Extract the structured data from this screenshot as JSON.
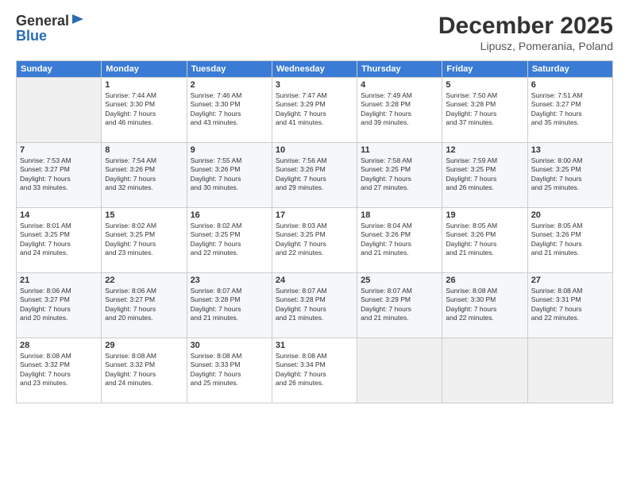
{
  "logo": {
    "general": "General",
    "blue": "Blue"
  },
  "header": {
    "month": "December 2025",
    "location": "Lipusz, Pomerania, Poland"
  },
  "weekdays": [
    "Sunday",
    "Monday",
    "Tuesday",
    "Wednesday",
    "Thursday",
    "Friday",
    "Saturday"
  ],
  "weeks": [
    [
      {
        "day": "",
        "info": ""
      },
      {
        "day": "1",
        "info": "Sunrise: 7:44 AM\nSunset: 3:30 PM\nDaylight: 7 hours\nand 46 minutes."
      },
      {
        "day": "2",
        "info": "Sunrise: 7:46 AM\nSunset: 3:30 PM\nDaylight: 7 hours\nand 43 minutes."
      },
      {
        "day": "3",
        "info": "Sunrise: 7:47 AM\nSunset: 3:29 PM\nDaylight: 7 hours\nand 41 minutes."
      },
      {
        "day": "4",
        "info": "Sunrise: 7:49 AM\nSunset: 3:28 PM\nDaylight: 7 hours\nand 39 minutes."
      },
      {
        "day": "5",
        "info": "Sunrise: 7:50 AM\nSunset: 3:28 PM\nDaylight: 7 hours\nand 37 minutes."
      },
      {
        "day": "6",
        "info": "Sunrise: 7:51 AM\nSunset: 3:27 PM\nDaylight: 7 hours\nand 35 minutes."
      }
    ],
    [
      {
        "day": "7",
        "info": "Sunrise: 7:53 AM\nSunset: 3:27 PM\nDaylight: 7 hours\nand 33 minutes."
      },
      {
        "day": "8",
        "info": "Sunrise: 7:54 AM\nSunset: 3:26 PM\nDaylight: 7 hours\nand 32 minutes."
      },
      {
        "day": "9",
        "info": "Sunrise: 7:55 AM\nSunset: 3:26 PM\nDaylight: 7 hours\nand 30 minutes."
      },
      {
        "day": "10",
        "info": "Sunrise: 7:56 AM\nSunset: 3:26 PM\nDaylight: 7 hours\nand 29 minutes."
      },
      {
        "day": "11",
        "info": "Sunrise: 7:58 AM\nSunset: 3:25 PM\nDaylight: 7 hours\nand 27 minutes."
      },
      {
        "day": "12",
        "info": "Sunrise: 7:59 AM\nSunset: 3:25 PM\nDaylight: 7 hours\nand 26 minutes."
      },
      {
        "day": "13",
        "info": "Sunrise: 8:00 AM\nSunset: 3:25 PM\nDaylight: 7 hours\nand 25 minutes."
      }
    ],
    [
      {
        "day": "14",
        "info": "Sunrise: 8:01 AM\nSunset: 3:25 PM\nDaylight: 7 hours\nand 24 minutes."
      },
      {
        "day": "15",
        "info": "Sunrise: 8:02 AM\nSunset: 3:25 PM\nDaylight: 7 hours\nand 23 minutes."
      },
      {
        "day": "16",
        "info": "Sunrise: 8:02 AM\nSunset: 3:25 PM\nDaylight: 7 hours\nand 22 minutes."
      },
      {
        "day": "17",
        "info": "Sunrise: 8:03 AM\nSunset: 3:25 PM\nDaylight: 7 hours\nand 22 minutes."
      },
      {
        "day": "18",
        "info": "Sunrise: 8:04 AM\nSunset: 3:26 PM\nDaylight: 7 hours\nand 21 minutes."
      },
      {
        "day": "19",
        "info": "Sunrise: 8:05 AM\nSunset: 3:26 PM\nDaylight: 7 hours\nand 21 minutes."
      },
      {
        "day": "20",
        "info": "Sunrise: 8:05 AM\nSunset: 3:26 PM\nDaylight: 7 hours\nand 21 minutes."
      }
    ],
    [
      {
        "day": "21",
        "info": "Sunrise: 8:06 AM\nSunset: 3:27 PM\nDaylight: 7 hours\nand 20 minutes."
      },
      {
        "day": "22",
        "info": "Sunrise: 8:06 AM\nSunset: 3:27 PM\nDaylight: 7 hours\nand 20 minutes."
      },
      {
        "day": "23",
        "info": "Sunrise: 8:07 AM\nSunset: 3:28 PM\nDaylight: 7 hours\nand 21 minutes."
      },
      {
        "day": "24",
        "info": "Sunrise: 8:07 AM\nSunset: 3:28 PM\nDaylight: 7 hours\nand 21 minutes."
      },
      {
        "day": "25",
        "info": "Sunrise: 8:07 AM\nSunset: 3:29 PM\nDaylight: 7 hours\nand 21 minutes."
      },
      {
        "day": "26",
        "info": "Sunrise: 8:08 AM\nSunset: 3:30 PM\nDaylight: 7 hours\nand 22 minutes."
      },
      {
        "day": "27",
        "info": "Sunrise: 8:08 AM\nSunset: 3:31 PM\nDaylight: 7 hours\nand 22 minutes."
      }
    ],
    [
      {
        "day": "28",
        "info": "Sunrise: 8:08 AM\nSunset: 3:32 PM\nDaylight: 7 hours\nand 23 minutes."
      },
      {
        "day": "29",
        "info": "Sunrise: 8:08 AM\nSunset: 3:32 PM\nDaylight: 7 hours\nand 24 minutes."
      },
      {
        "day": "30",
        "info": "Sunrise: 8:08 AM\nSunset: 3:33 PM\nDaylight: 7 hours\nand 25 minutes."
      },
      {
        "day": "31",
        "info": "Sunrise: 8:08 AM\nSunset: 3:34 PM\nDaylight: 7 hours\nand 26 minutes."
      },
      {
        "day": "",
        "info": ""
      },
      {
        "day": "",
        "info": ""
      },
      {
        "day": "",
        "info": ""
      }
    ]
  ]
}
